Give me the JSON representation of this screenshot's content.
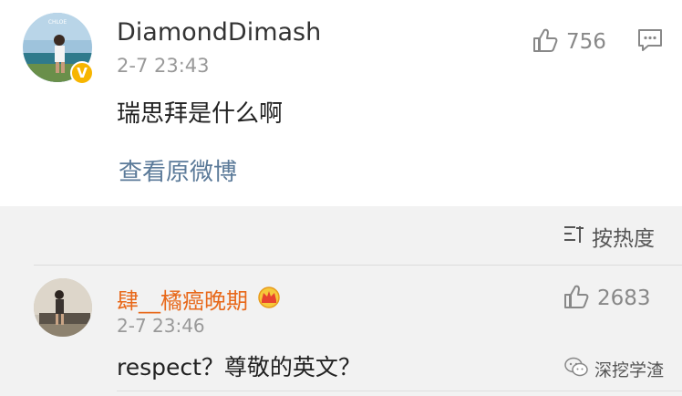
{
  "comment": {
    "username": "DiamondDimash",
    "timestamp": "2-7 23:43",
    "text": "瑞思拜是什么啊",
    "view_original_label": "查看原微博",
    "like_count": "756",
    "verified_badge": "V",
    "avatar_caption": "CHLOE"
  },
  "sort": {
    "label": "按热度"
  },
  "reply": {
    "username": "肆__橘癌晚期",
    "timestamp": "2-7 23:46",
    "text": "respect？尊敬的英文？",
    "like_count": "2683"
  },
  "watermark": {
    "text": "深挖学渣"
  },
  "colors": {
    "accent_orange": "#e8691b",
    "link_blue": "#5b7a99",
    "badge_gold": "#f7b500",
    "background_gray": "#f2f2f2"
  }
}
